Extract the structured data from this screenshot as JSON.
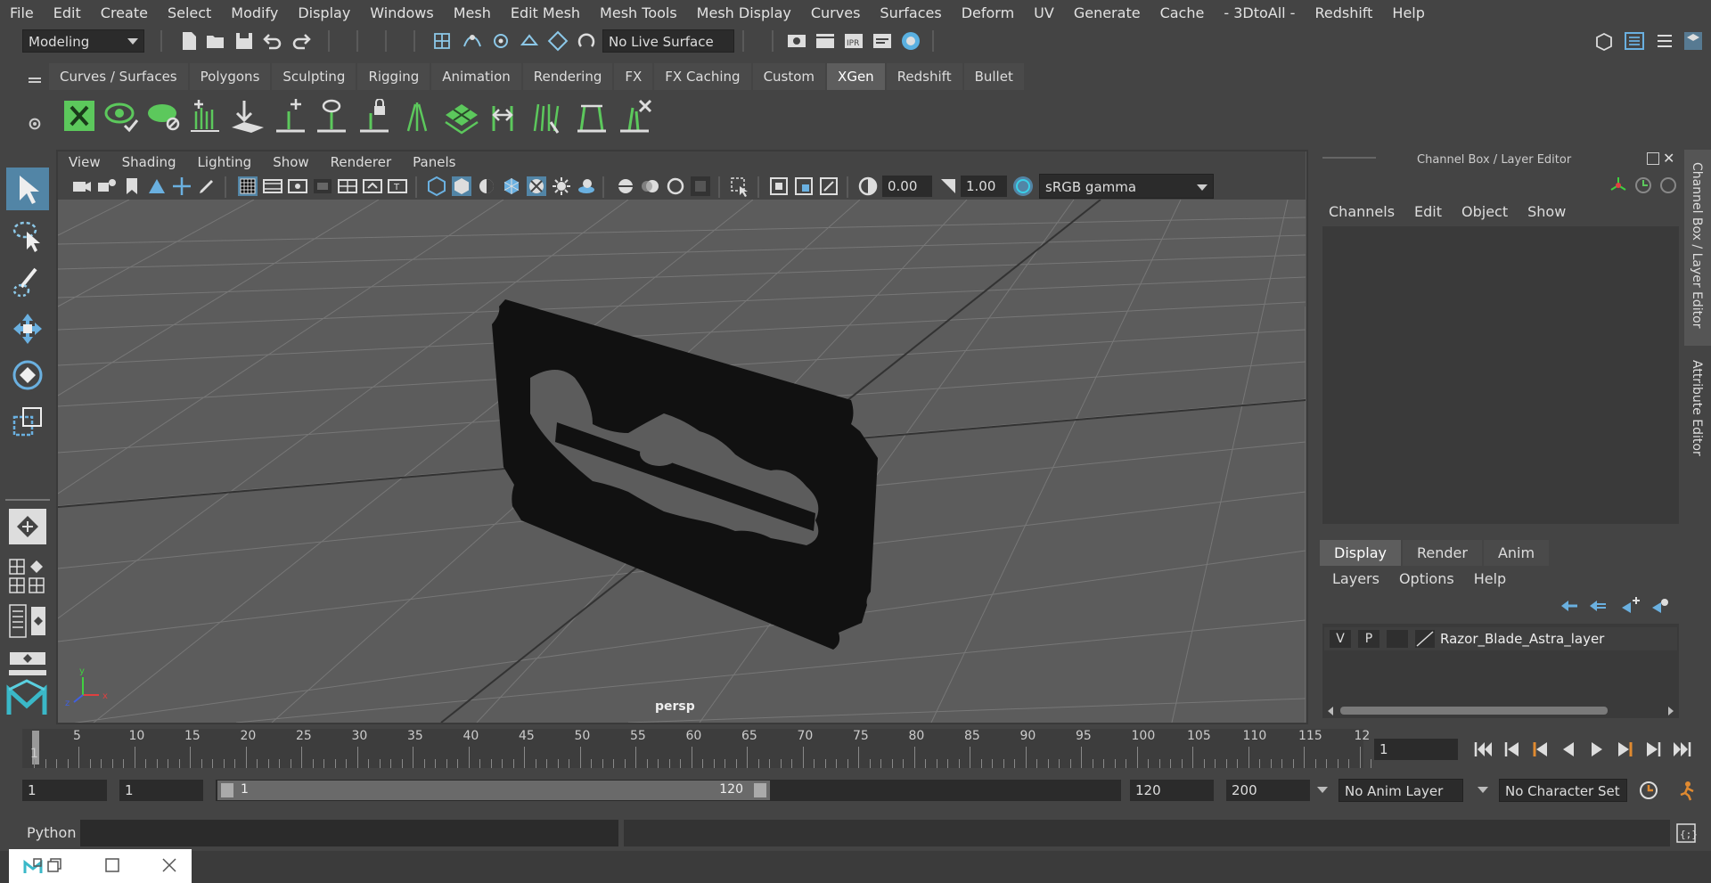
{
  "menubar": {
    "items": [
      "File",
      "Edit",
      "Create",
      "Select",
      "Modify",
      "Display",
      "Windows",
      "Mesh",
      "Edit Mesh",
      "Mesh Tools",
      "Mesh Display",
      "Curves",
      "Surfaces",
      "Deform",
      "UV",
      "Generate",
      "Cache",
      "- 3DtoAll -",
      "Redshift",
      "Help"
    ]
  },
  "status": {
    "workspace": "Modeling",
    "live_surface": "No Live Surface"
  },
  "shelf": {
    "tabs": [
      "Curves / Surfaces",
      "Polygons",
      "Sculpting",
      "Rigging",
      "Animation",
      "Rendering",
      "FX",
      "FX Caching",
      "Custom",
      "XGen",
      "Redshift",
      "Bullet"
    ],
    "active_tab": "XGen"
  },
  "viewport": {
    "menu": [
      "View",
      "Shading",
      "Lighting",
      "Show",
      "Renderer",
      "Panels"
    ],
    "exposure": "0.00",
    "gamma": "1.00",
    "color_space": "sRGB gamma",
    "camera_label": "persp"
  },
  "channel_box": {
    "title": "Channel Box / Layer Editor",
    "menu": [
      "Channels",
      "Edit",
      "Object",
      "Show"
    ]
  },
  "layer_editor": {
    "tabs": [
      "Display",
      "Render",
      "Anim"
    ],
    "active_tab": "Display",
    "menu": [
      "Layers",
      "Options",
      "Help"
    ],
    "layer": {
      "v": "V",
      "p": "P",
      "name": "Razor_Blade_Astra_layer"
    }
  },
  "side_tabs": {
    "channel": "Channel Box / Layer Editor",
    "attribute": "Attribute Editor"
  },
  "timeline": {
    "labels": [
      "1",
      "5",
      "10",
      "15",
      "20",
      "25",
      "30",
      "35",
      "40",
      "45",
      "50",
      "55",
      "60",
      "65",
      "70",
      "75",
      "80",
      "85",
      "90",
      "95",
      "100",
      "105",
      "110",
      "115",
      "12"
    ],
    "current_frame": "1"
  },
  "range": {
    "start": "1",
    "playback_start": "1",
    "slider_start": "1",
    "slider_end": "120",
    "playback_end": "120",
    "end": "200",
    "anim_layer": "No Anim Layer",
    "character_set": "No Character Set"
  },
  "cmdline": {
    "language": "Python"
  },
  "colors": {
    "accent": "#5285a6",
    "xgen_green": "#5cc85c",
    "background": "#444444",
    "viewport": "#5c5c5c"
  }
}
